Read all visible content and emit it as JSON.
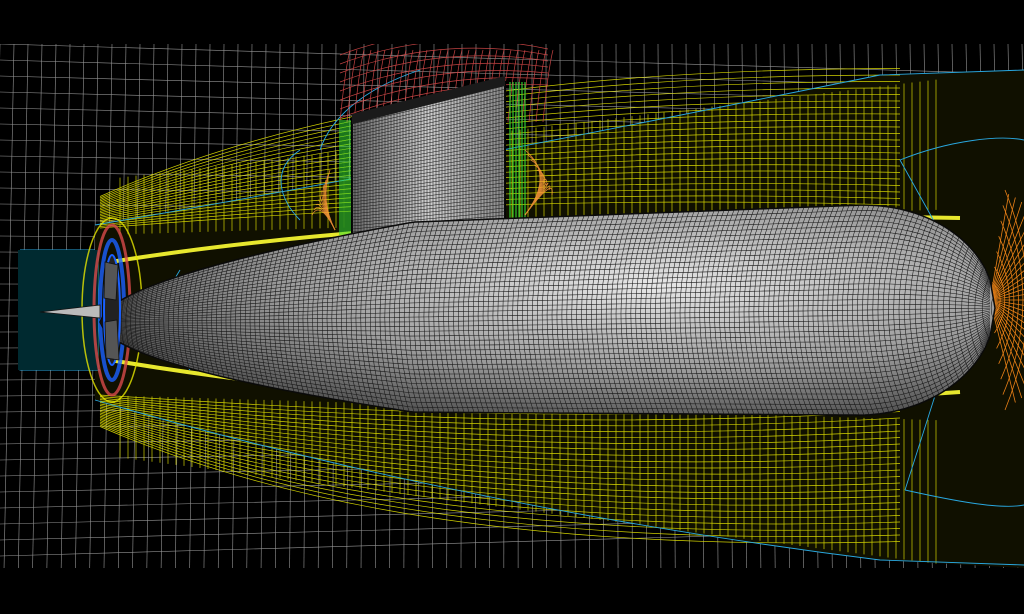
{
  "scene": {
    "subject": "submarine-hull-mesh",
    "colors": {
      "background": "#000000",
      "far_field_grid": "#c8c8c8",
      "near_wall_mesh": "#e6e600",
      "boundary_layer_edge": "#ffff33",
      "block_lines": "#29a8e0",
      "bow_mesh": "#ff8c1a",
      "sail_cap_mesh": "#d84a4a",
      "sail_side_mesh": "#33dd33",
      "stern_mesh": "#22d8e8",
      "hull_fill": "#8a8a8a",
      "hull_grid": "#151515"
    },
    "icons": [
      "hull-icon",
      "sail-icon",
      "propeller-icon"
    ]
  }
}
